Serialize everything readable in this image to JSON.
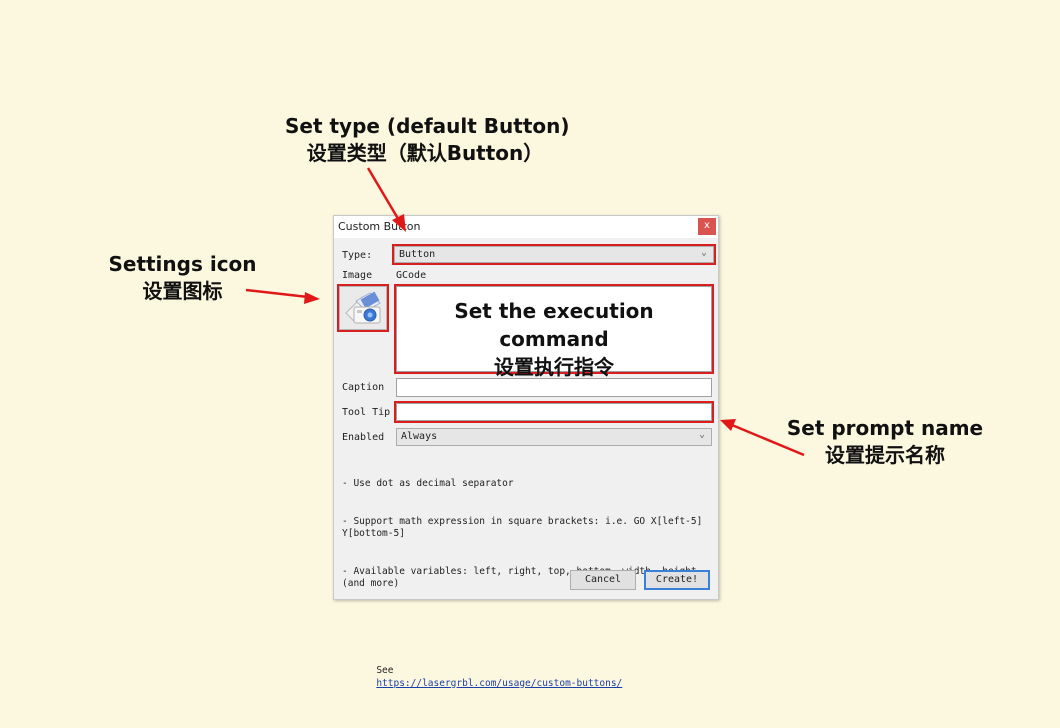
{
  "annotations": {
    "type": {
      "en": "Set type (default Button)",
      "zh": "设置类型（默认Button）"
    },
    "icon": {
      "en": "Settings icon",
      "zh": "设置图标"
    },
    "command": {
      "en": "Set the execution command",
      "zh": "设置执行指令"
    },
    "tooltip": {
      "en": "Set prompt name",
      "zh": "设置提示名称"
    },
    "highlight_color": "#d81e1e"
  },
  "dialog": {
    "title": "Custom Button",
    "close_label": "x",
    "type_label": "Type:",
    "type_value": "Button",
    "image_label": "Image",
    "gcode_label": "GCode",
    "gcode_value": "",
    "image_icon": "custom-button-image-icon",
    "caption_label": "Caption",
    "caption_value": "",
    "tooltip_label": "Tool Tip",
    "tooltip_value": "",
    "enabled_label": "Enabled",
    "enabled_value": "Always",
    "help_lines": [
      "- Use dot as decimal separator",
      "- Support math expression in square brackets: i.e. GO X[left-5] Y[bottom-5]",
      "- Available variables: left, right, top, bottom, width, height.. (and more)"
    ],
    "see_label": "See",
    "link_text": "https://lasergrbl.com/usage/custom-buttons/",
    "cancel_label": "Cancel",
    "create_label": "Create!"
  }
}
